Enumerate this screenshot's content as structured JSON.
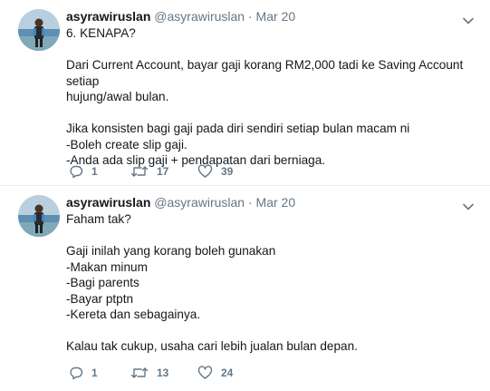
{
  "tweets": [
    {
      "display_name": "asyrawiruslan",
      "handle": "@asyrawiruslan",
      "separator": "·",
      "date": "Mar 20",
      "lines": [
        "6. KENAPA?",
        "",
        "Dari Current Account, bayar gaji korang RM2,000 tadi ke Saving Account setiap",
        "hujung/awal bulan.",
        "",
        "Jika konsisten bagi gaji pada diri sendiri setiap bulan macam ni",
        "-Boleh create slip gaji.",
        "-Anda ada slip gaji + pendapatan dari berniaga."
      ],
      "replies": "1",
      "retweets": "17",
      "likes": "39"
    },
    {
      "display_name": "asyrawiruslan",
      "handle": "@asyrawiruslan",
      "separator": "·",
      "date": "Mar 20",
      "lines": [
        "Faham tak?",
        "",
        "Gaji inilah yang korang boleh gunakan",
        "-Makan minum",
        "-Bagi parents",
        "-Bayar ptptn",
        "-Kereta dan sebagainya.",
        "",
        "Kalau tak cukup, usaha cari lebih jualan bulan depan."
      ],
      "replies": "1",
      "retweets": "13",
      "likes": "24"
    }
  ],
  "icons": {
    "reply": "reply-icon",
    "retweet": "retweet-icon",
    "like": "heart-icon",
    "menu": "chevron-down-icon"
  },
  "colors": {
    "text": "#14171a",
    "muted": "#657786",
    "separator": "#e6ecf0"
  }
}
